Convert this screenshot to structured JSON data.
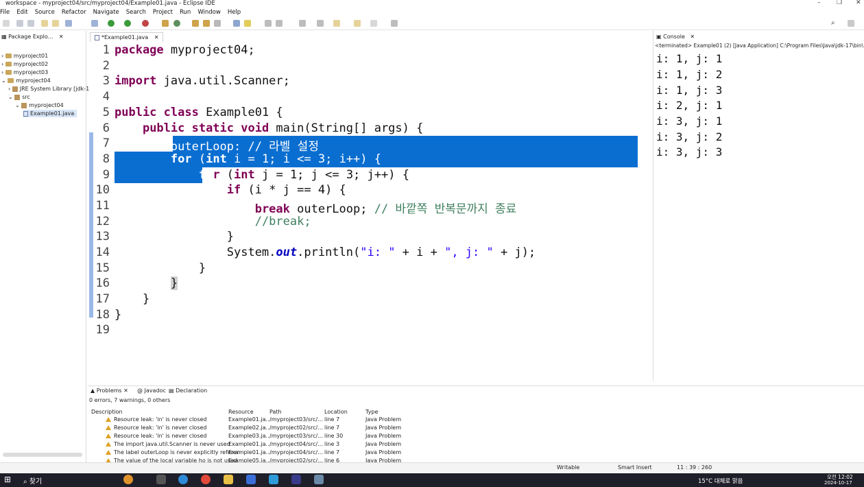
{
  "window": {
    "title": "workspace - myproject04/src/myproject04/Example01.java - Eclipse IDE"
  },
  "menu": [
    "File",
    "Edit",
    "Source",
    "Refactor",
    "Navigate",
    "Search",
    "Project",
    "Run",
    "Window",
    "Help"
  ],
  "package_explorer": {
    "tab": "Package Explo...",
    "items": [
      {
        "label": "myproject01",
        "depth": 0
      },
      {
        "label": "myproject02",
        "depth": 0
      },
      {
        "label": "myproject03",
        "depth": 0
      },
      {
        "label": "myproject04",
        "depth": 0
      },
      {
        "label": "JRE System Library [jdk-1",
        "depth": 1
      },
      {
        "label": "src",
        "depth": 1
      },
      {
        "label": "myproject04",
        "depth": 2
      },
      {
        "label": "Example01.java",
        "depth": 3
      }
    ]
  },
  "editor": {
    "tab": "*Example01.java",
    "lines": [
      "1",
      "2",
      "3",
      "4",
      "5",
      "6",
      "7",
      "8",
      "9",
      "10",
      "11",
      "12",
      "13",
      "14",
      "15",
      "16",
      "17",
      "18",
      "19"
    ]
  },
  "console": {
    "tab": "Console",
    "header": "<terminated> Example01 (2) [Java Application] C:\\Program Files\\Java\\jdk-17\\bin\\",
    "lines": [
      "i: 1, j: 1",
      "i: 1, j: 2",
      "i: 1, j: 3",
      "i: 2, j: 1",
      "i: 3, j: 1",
      "i: 3, j: 2",
      "i: 3, j: 3"
    ]
  },
  "problems": {
    "tabs": [
      "Problems",
      "Javadoc",
      "Declaration"
    ],
    "summary": "0 errors, 7 warnings, 0 others",
    "columns": [
      "Description",
      "Resource",
      "Path",
      "Location",
      "Type"
    ],
    "rows": [
      [
        "Resource leak: 'in' is never closed",
        "Example01.ja...",
        "/myproject03/src/...",
        "line 7",
        "Java Problem"
      ],
      [
        "Resource leak: 'in' is never closed",
        "Example02.ja...",
        "/myproject02/src/...",
        "line 7",
        "Java Problem"
      ],
      [
        "Resource leak: 'in' is never closed",
        "Example03.ja...",
        "/myproject03/src/...",
        "line 30",
        "Java Problem"
      ],
      [
        "The import java.util.Scanner is never used",
        "Example01.ja...",
        "/myproject04/src/...",
        "line 3",
        "Java Problem"
      ],
      [
        "The label outerLoop is never explicitly referen",
        "Example01.ja...",
        "/myproject04/src/...",
        "line 7",
        "Java Problem"
      ],
      [
        "The value of the local variable ho is not used",
        "Example05.ja...",
        "/myproject02/src/...",
        "line 6",
        "Java Problem"
      ]
    ]
  },
  "status": {
    "writable": "Writable",
    "insert": "Smart Insert",
    "position": "11 : 39 : 260"
  },
  "taskbar": {
    "search": "찾기",
    "weather": "15°C 대체로 맑음",
    "time": "오전 12:02",
    "date": "2024-10-17"
  }
}
